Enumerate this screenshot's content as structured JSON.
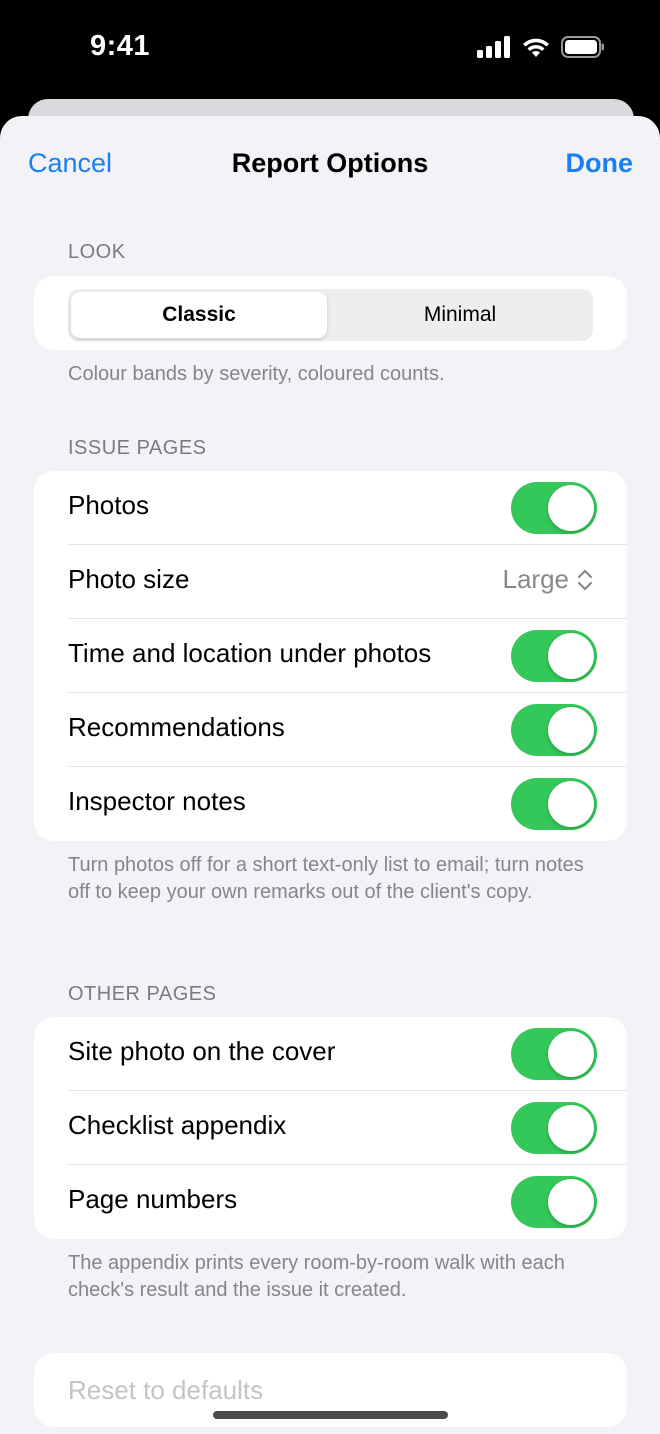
{
  "status_bar": {
    "time": "9:41"
  },
  "nav": {
    "cancel": "Cancel",
    "title": "Report Options",
    "done": "Done"
  },
  "look": {
    "header": "LOOK",
    "options": [
      "Classic",
      "Minimal"
    ],
    "selected": "Classic",
    "footer": "Colour bands by severity, coloured counts."
  },
  "issue_pages": {
    "header": "ISSUE PAGES",
    "rows": [
      {
        "label": "Photos",
        "type": "toggle",
        "on": true
      },
      {
        "label": "Photo size",
        "type": "popup",
        "value": "Large"
      },
      {
        "label": "Time and location under photos",
        "type": "toggle",
        "on": true
      },
      {
        "label": "Recommendations",
        "type": "toggle",
        "on": true
      },
      {
        "label": "Inspector notes",
        "type": "toggle",
        "on": true
      }
    ],
    "footer": "Turn photos off for a short text-only list to email; turn notes off to keep your own remarks out of the client's copy."
  },
  "other_pages": {
    "header": "OTHER PAGES",
    "rows": [
      {
        "label": "Site photo on the cover",
        "type": "toggle",
        "on": true
      },
      {
        "label": "Checklist appendix",
        "type": "toggle",
        "on": true
      },
      {
        "label": "Page numbers",
        "type": "toggle",
        "on": true
      }
    ],
    "footer": "The appendix prints every room-by-room walk with each check's result and the issue it created."
  },
  "reset": {
    "label": "Reset to defaults"
  },
  "colors": {
    "accent": "#1a7ff0",
    "toggle_on": "#34c759",
    "background": "#f2f2f7"
  }
}
